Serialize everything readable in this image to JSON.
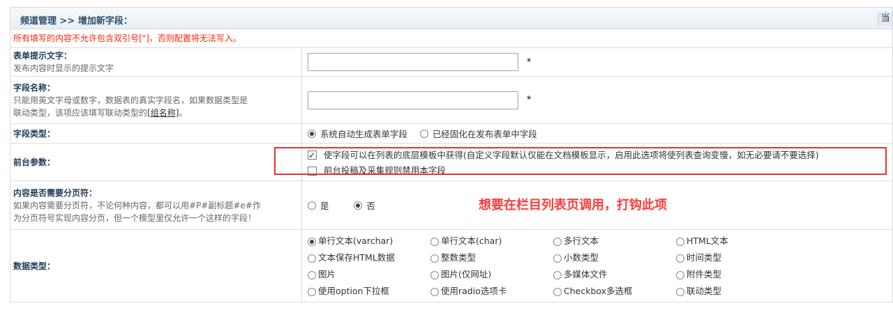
{
  "header": {
    "breadcrumb": "频道管理 >> 增加新字段：",
    "corner_button": "当"
  },
  "warning": "所有填写的内容不允许包含双引号[\"]，否则配置将无法写入。",
  "fields": {
    "form_hint": {
      "title": "表单提示文字：",
      "desc": "发布内容时显示的提示文字",
      "value": "",
      "required": "*"
    },
    "field_name": {
      "title": "字段名称：",
      "desc1": "只能用英文字母或数字，数据表的真实字段名，如果数据类型是",
      "desc2": "联动类型，该项应该填写联动类型的",
      "desc2_link": "[组名称]",
      "desc2_end": "。",
      "value": "",
      "required": "*"
    },
    "field_type": {
      "title": "字段类型：",
      "options": [
        "系统自动生成表单字段",
        "已经固化在发布表单中字段"
      ],
      "selected": 0
    },
    "frontend": {
      "title": "前台参数：",
      "checkbox1": {
        "label": "使字段可以在列表的底层模板中获得(自定义字段默认仅能在文档模板显示，启用此选项将使列表查询变慢，如无必要请不要选择)",
        "checked": true
      },
      "checkbox2": {
        "label": "前台投稿及采集规则禁用本字段",
        "checked": false
      }
    },
    "pagebreak": {
      "title": "内容是否需要分页符：",
      "desc1": "如果内容需要分页符，不论何种内容，都可以用#P#副标题#e#作",
      "desc2": "为分页符号实现内容分页，但一个模型里仅允许一个这样的字段！",
      "options": [
        "是",
        "否"
      ],
      "selected": 1
    },
    "datatype": {
      "title": "数据类型：",
      "options": [
        "单行文本(varchar)",
        "单行文本(char)",
        "多行文本",
        "HTML文本",
        "文本保存HTML数据",
        "整数类型",
        "小数类型",
        "时间类型",
        "图片",
        "图片(仅网址)",
        "多媒体文件",
        "附件类型",
        "使用option下拉框",
        "使用radio选项卡",
        "Checkbox多选框",
        "联动类型"
      ],
      "selected": 0
    }
  },
  "annotation": {
    "callout": "想要在栏目列表页调用，打钩此项",
    "highlight_color": "#e53333"
  }
}
